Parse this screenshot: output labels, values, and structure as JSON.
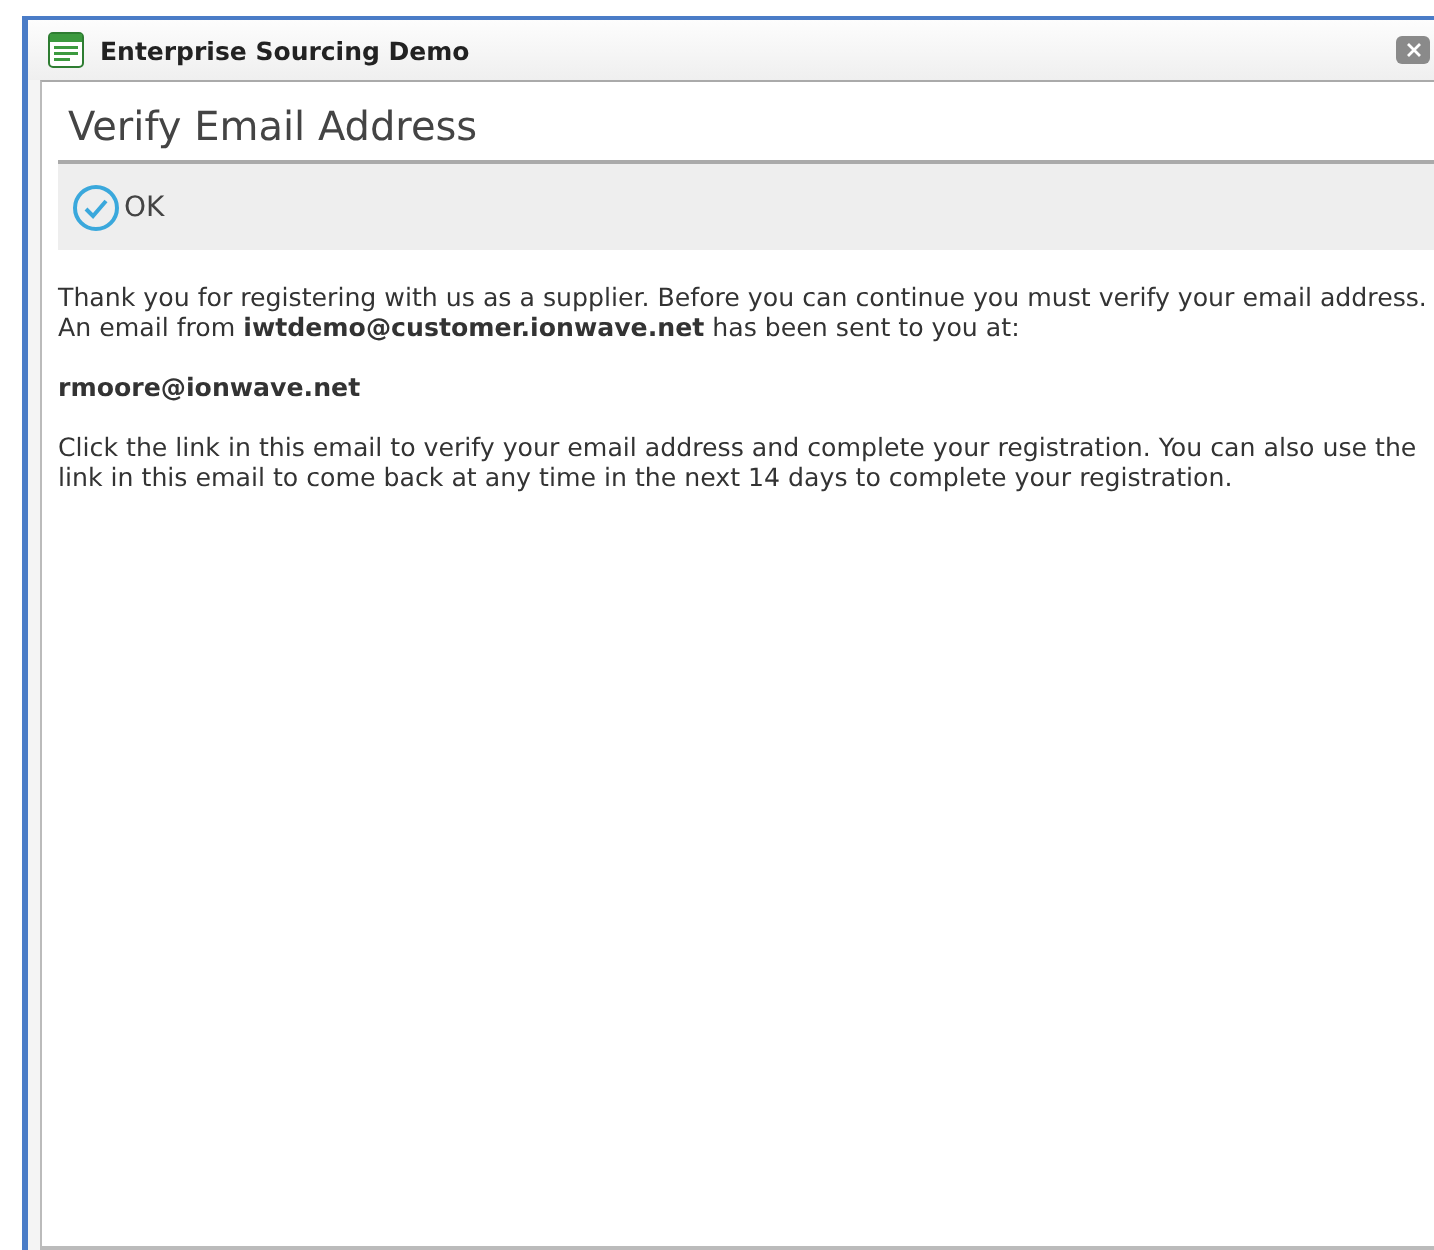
{
  "window": {
    "title": "Enterprise Sourcing Demo"
  },
  "page": {
    "heading": "Verify Email Address",
    "toolbar": [
      {
        "kind": "ok",
        "label": "OK"
      }
    ],
    "paragraphs": [
      {
        "kind": "text",
        "text": "Thank you for registering with us as a supplier. Before you can continue you must verify your email address. An email from **iwtdemo@customer.ionwave.net** has been sent to you at:"
      },
      {
        "kind": "email",
        "text": "rmoore@ionwave.net"
      },
      {
        "kind": "text",
        "text": "Click the link in this email to verify your email address and complete your registration. You can also use the link in this email to come back at any time in the next 14 days to complete your registration."
      }
    ]
  }
}
